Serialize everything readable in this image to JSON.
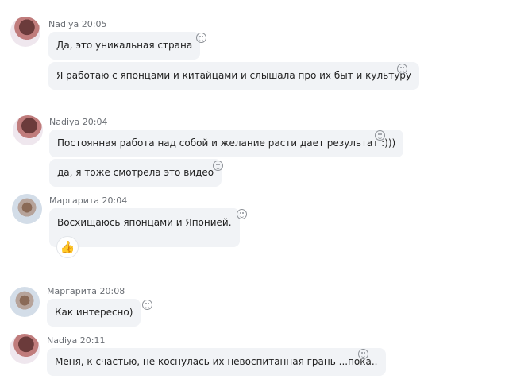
{
  "messages": [
    {
      "sender": "Nadiya 20:05",
      "texts": [
        "Да, это уникальная страна",
        "Я работаю с японцами и китайцами и слышала про их быт и культуру"
      ]
    },
    {
      "sender": "Nadiya 20:04",
      "texts": [
        "Постоянная работа над собой и желание расти дает результат :)))",
        "да, я тоже смотрела это видео"
      ]
    },
    {
      "sender": "Маргарита 20:04",
      "texts": [
        "Восхищаюсь японцами и Японией."
      ],
      "reaction": "thumbs-up"
    },
    {
      "sender": "Маргарита 20:08",
      "texts": [
        "Как интересно)"
      ]
    },
    {
      "sender": "Nadiya 20:11",
      "texts": [
        "Меня, к счастью, не коснулась их невоспитанная грань ...пока.."
      ]
    }
  ]
}
